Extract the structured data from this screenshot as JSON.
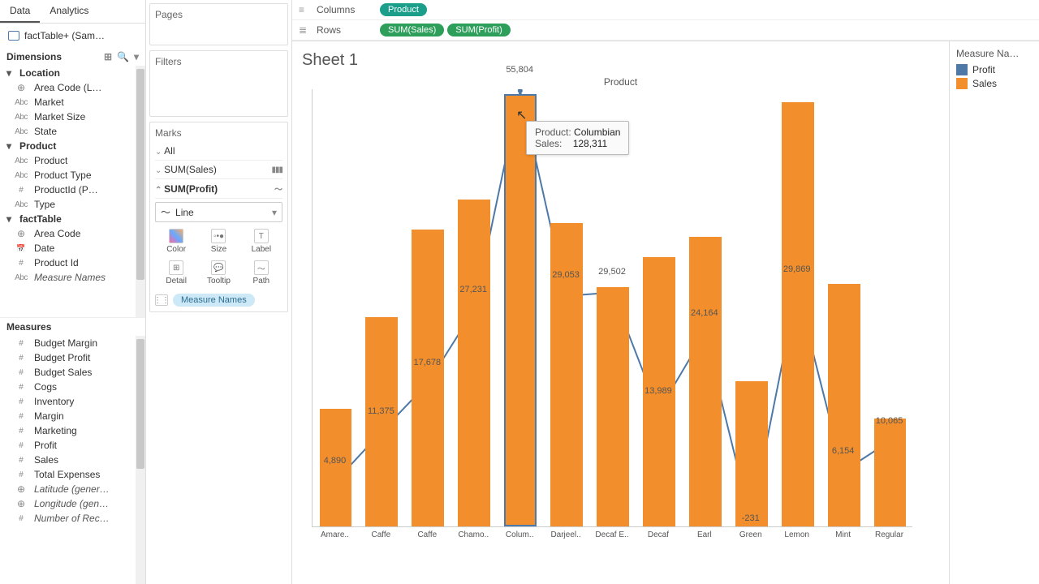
{
  "data_tabs": {
    "data": "Data",
    "analytics": "Analytics"
  },
  "datasource": "factTable+ (Sam…",
  "dimensions_hdr": "Dimensions",
  "dimensions_tree": {
    "location": {
      "label": "Location",
      "children": [
        "Area Code (L…",
        "Market",
        "Market Size",
        "State"
      ]
    },
    "product": {
      "label": "Product",
      "children": [
        "Product",
        "Product Type",
        "ProductId (P…",
        "Type"
      ]
    },
    "factTable": {
      "label": "factTable",
      "children": [
        "Area Code",
        "Date",
        "Product Id"
      ]
    },
    "measureNames": "Measure Names"
  },
  "measures_hdr": "Measures",
  "measures": [
    "Budget Margin",
    "Budget Profit",
    "Budget Sales",
    "Cogs",
    "Inventory",
    "Margin",
    "Marketing",
    "Profit",
    "Sales",
    "Total Expenses",
    "Latitude (gener…",
    "Longitude (gen…",
    "Number of Rec…"
  ],
  "cards": {
    "pages": "Pages",
    "filters": "Filters",
    "marks": "Marks",
    "all": "All",
    "sum_sales": "SUM(Sales)",
    "sum_profit": "SUM(Profit)",
    "mark_type": "Line",
    "cells": {
      "color": "Color",
      "size": "Size",
      "label": "Label",
      "detail": "Detail",
      "tooltip": "Tooltip",
      "path": "Path"
    },
    "measure_names_pill": "Measure Names"
  },
  "shelves": {
    "columns": "Columns",
    "rows": "Rows",
    "product_pill": "Product",
    "sum_sales_pill": "SUM(Sales)",
    "sum_profit_pill": "SUM(Profit)"
  },
  "sheet_title": "Sheet 1",
  "axis_top": "Product",
  "chart_data": {
    "type": "bar+line",
    "categories": [
      "Amare..",
      "Caffe",
      "Caffe",
      "Chamo..",
      "Colum..",
      "Darjeel..",
      "Decaf E..",
      "Decaf",
      "Earl",
      "Green",
      "Lemon",
      "Mint",
      "Regular"
    ],
    "sales": [
      35000,
      62000,
      88000,
      97000,
      128311,
      90000,
      71000,
      80000,
      86000,
      43000,
      126000,
      72000,
      32000
    ],
    "profit": [
      4890,
      11375,
      17678,
      27231,
      55804,
      29053,
      29502,
      13989,
      24164,
      -231,
      29869,
      6154,
      10065
    ],
    "profit_labels": [
      "4,890",
      "11,375",
      "17,678",
      "27,231",
      "55,804",
      "29,053",
      "29,502",
      "13,989",
      "24,164",
      "-231",
      "29,869",
      "6,154",
      "10,065"
    ],
    "sales_max": 130000,
    "profit_range": [
      -1000,
      56000
    ]
  },
  "tooltip": {
    "product_lbl": "Product:",
    "product_val": "Columbian",
    "sales_lbl": "Sales:",
    "sales_val": "128,311"
  },
  "legend": {
    "title": "Measure Na…",
    "profit": "Profit",
    "sales": "Sales"
  }
}
